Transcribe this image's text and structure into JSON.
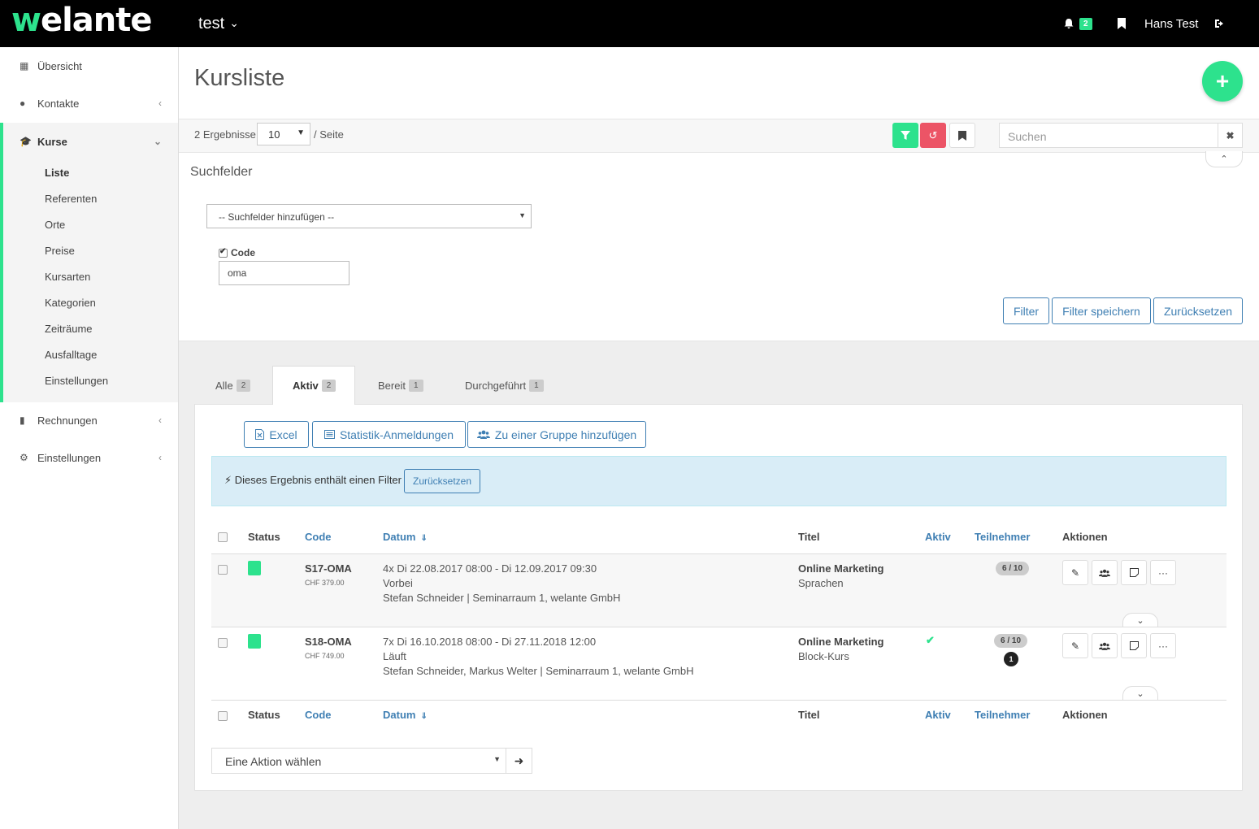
{
  "topbar": {
    "logo_w": "w",
    "logo_rest": "elante",
    "project": "test",
    "notifications_count": "2",
    "user_name": "Hans Test"
  },
  "sidebar": {
    "items": [
      {
        "label": "Übersicht",
        "icon": "dashboard-icon"
      },
      {
        "label": "Kontakte",
        "icon": "user-icon"
      },
      {
        "label": "Kurse",
        "icon": "graduation-cap-icon"
      },
      {
        "label": "Rechnungen",
        "icon": "file-icon"
      },
      {
        "label": "Einstellungen",
        "icon": "gears-icon"
      }
    ],
    "kurse_sub": [
      "Liste",
      "Referenten",
      "Orte",
      "Preise",
      "Kursarten",
      "Kategorien",
      "Zeiträume",
      "Ausfalltage",
      "Einstellungen"
    ]
  },
  "main": {
    "title": "Kursliste",
    "results_text": "2 Ergebnisse",
    "per_page": "10",
    "per_page_suffix": "/ Seite",
    "search_placeholder": "Suchen"
  },
  "search_fields": {
    "title": "Suchfelder",
    "add_select": "-- Suchfelder hinzufügen --",
    "code_label": "Code",
    "code_value": "oma",
    "btn_filter": "Filter",
    "btn_save": "Filter speichern",
    "btn_reset": "Zurücksetzen"
  },
  "tabs": [
    {
      "label": "Alle",
      "count": "2"
    },
    {
      "label": "Aktiv",
      "count": "2"
    },
    {
      "label": "Bereit",
      "count": "1"
    },
    {
      "label": "Durchgeführt",
      "count": "1"
    }
  ],
  "actions": {
    "excel": "Excel",
    "stats": "Statistik-Anmeldungen",
    "group": "Zu einer Gruppe hinzufügen"
  },
  "alert": {
    "text": "Dieses Ergebnis enthält einen Filter",
    "button": "Zurücksetzen"
  },
  "table": {
    "headers": {
      "status": "Status",
      "code": "Code",
      "datum": "Datum",
      "titel": "Titel",
      "aktiv": "Aktiv",
      "teilnehmer": "Teilnehmer",
      "aktionen": "Aktionen"
    },
    "rows": [
      {
        "code": "S17-OMA",
        "price": "CHF 379.00",
        "date": "4x Di 22.08.2017 08:00 - Di 12.09.2017 09:30",
        "state": "Vorbei",
        "people": "Stefan Schneider | Seminarraum 1, welante GmbH",
        "title": "Online Marketing",
        "subtitle": "Sprachen",
        "participants": "6 / 10"
      },
      {
        "code": "S18-OMA",
        "price": "CHF 749.00",
        "date": "7x Di 16.10.2018 08:00 - Di 27.11.2018 12:00",
        "state": "Läuft",
        "people": "Stefan Schneider, Markus Welter | Seminarraum 1, welante GmbH",
        "title": "Online Marketing",
        "subtitle": "Block-Kurs",
        "participants": "6 / 10",
        "waiting": "1"
      }
    ]
  },
  "bulk": {
    "select": "Eine Aktion wählen"
  },
  "colors": {
    "accent": "#2de28d",
    "danger": "#ec5466",
    "link": "#3f7fb3"
  }
}
